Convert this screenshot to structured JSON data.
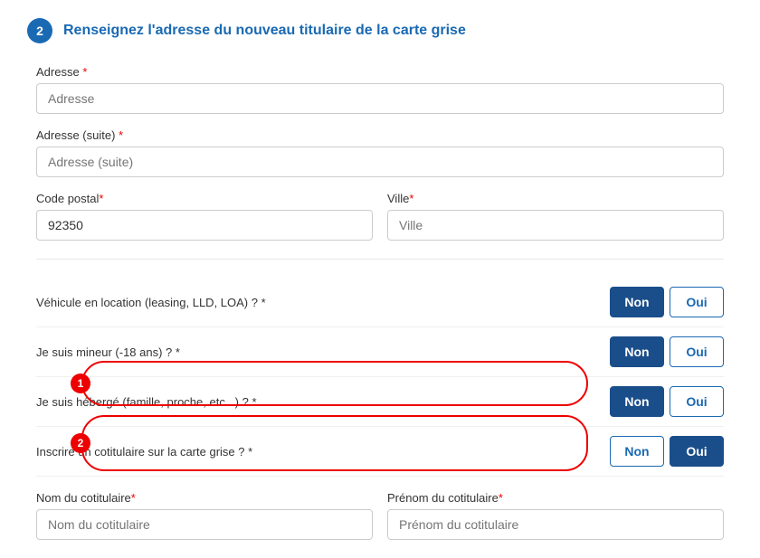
{
  "step": {
    "number": "2",
    "title": "Renseignez l'adresse du nouveau titulaire de la carte grise"
  },
  "form": {
    "adresse_label": "Adresse",
    "adresse_placeholder": "Adresse",
    "adresse_suite_label": "Adresse (suite)",
    "adresse_suite_placeholder": "Adresse (suite)",
    "code_postal_label": "Code postal",
    "code_postal_value": "92350",
    "ville_label": "Ville",
    "ville_placeholder": "Ville",
    "required_mark": " *"
  },
  "questions": [
    {
      "id": "leasing",
      "label": "Véhicule en location (leasing, LLD, LOA) ? *",
      "non_active": true,
      "oui_active": false
    },
    {
      "id": "mineur",
      "label": "Je suis mineur (-18 ans) ? *",
      "non_active": true,
      "oui_active": false
    },
    {
      "id": "heberge",
      "label": "Je suis hébergé (famille, proche, etc...) ? *",
      "non_active": true,
      "oui_active": false
    },
    {
      "id": "cotitulaire",
      "label": "Inscrire un cotitulaire sur la carte grise ? *",
      "non_active": false,
      "oui_active": true
    }
  ],
  "cotitulaire": {
    "nom_label": "Nom du cotitulaire",
    "nom_placeholder": "Nom du cotitulaire",
    "prenom_label": "Prénom du cotitulaire",
    "prenom_placeholder": "Prénom du cotitulaire"
  },
  "buttons": {
    "non": "Non",
    "oui": "Oui"
  },
  "annotations": {
    "circle1_number": "1",
    "circle2_number": "2"
  }
}
